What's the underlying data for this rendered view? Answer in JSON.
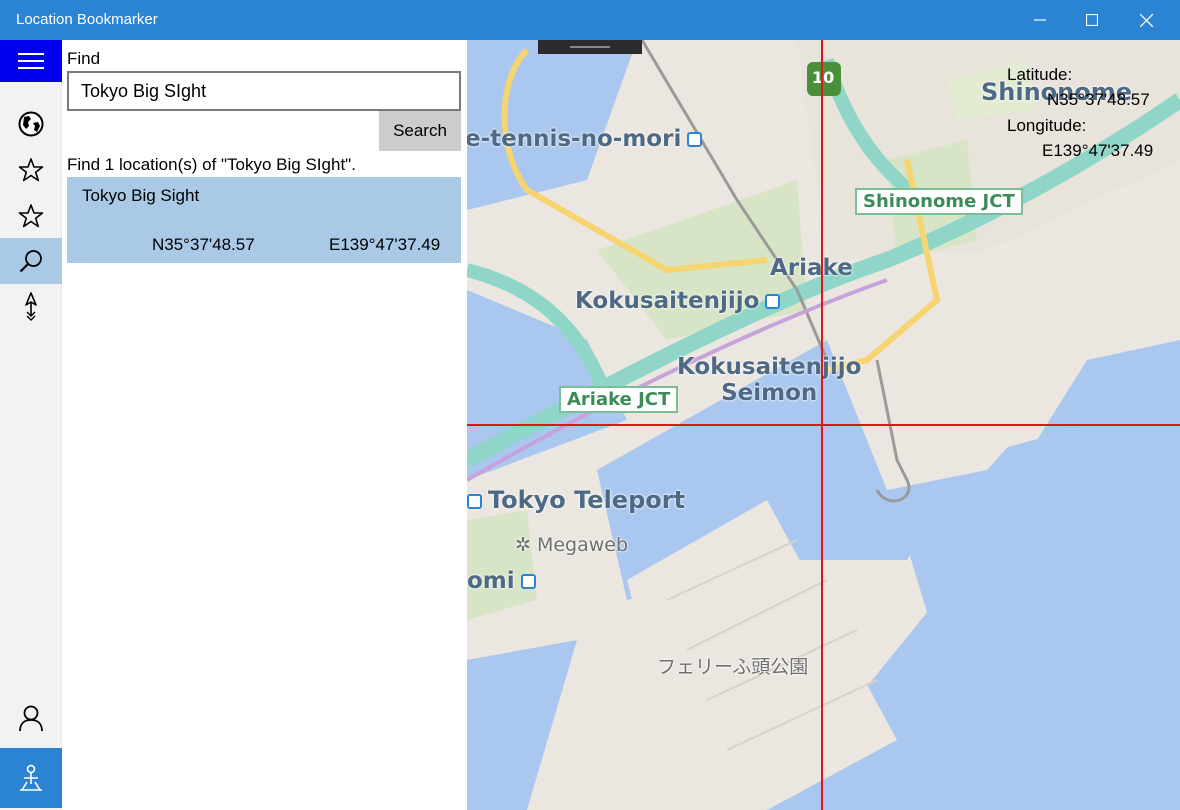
{
  "window": {
    "title": "Location Bookmarker",
    "accent_color": "#2b83d3",
    "controls": [
      "minimize-icon",
      "maximize-icon",
      "close-icon"
    ]
  },
  "rail": {
    "items": [
      {
        "icon": "hamburger-menu-icon"
      },
      {
        "icon": "globe-icon"
      },
      {
        "icon": "star-outline-icon"
      },
      {
        "icon": "star-outline-icon"
      },
      {
        "icon": "search-icon",
        "active": true
      },
      {
        "icon": "navigation-arrow-icon"
      },
      {
        "icon": "person-icon"
      },
      {
        "icon": "map-pin-location-icon"
      }
    ]
  },
  "find": {
    "label": "Find",
    "query": "Tokyo Big SIght",
    "search_button": "Search",
    "result_count_text": "Find 1 location(s) of \"Tokyo Big SIght\".",
    "results": [
      {
        "name": "Tokyo Big Sight",
        "latitude": "N35°37'48.57",
        "longitude": "E139°47'37.49"
      }
    ]
  },
  "map": {
    "latitude_label": "Latitude:",
    "latitude_value": "N35°37'48.57",
    "longitude_label": "Longitude:",
    "longitude_value": "E139°47'37.49",
    "crosshair_color": "#e0161b",
    "route_shield": "10",
    "labels": {
      "shinonome": "Shinonome",
      "tennis": "e-tennis-no-mori",
      "shinonome_jct": "Shinonome JCT",
      "ariake": "Ariake",
      "kokusaitenjijo": "Kokusaitenjijo",
      "kokusaitenjijo_seimon_1": "Kokusaitenjijo",
      "kokusaitenjijo_seimon_2": "Seimon",
      "ariake_jct": "Ariake JCT",
      "tokyo_teleport": "Tokyo Teleport",
      "megaweb": "Megaweb",
      "omi": "omi",
      "ferry_park": "フェリーふ頭公園"
    }
  }
}
